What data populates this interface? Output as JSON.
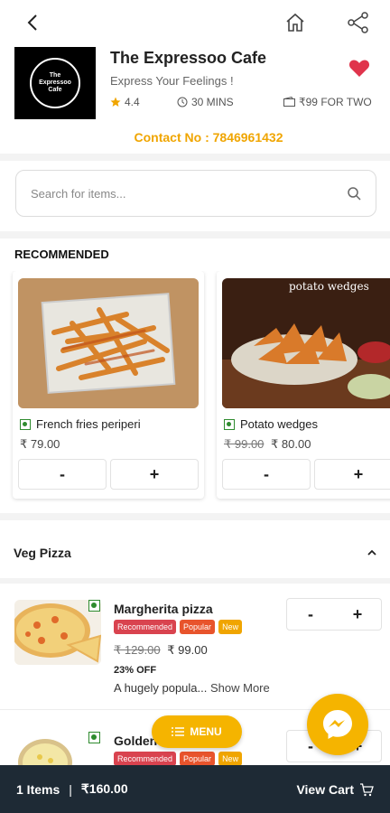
{
  "restaurant": {
    "name": "The Expressoo Cafe",
    "tagline": "Express Your Feelings !",
    "rating": "4.4",
    "time": "30 MINS",
    "cost": "₹99 FOR TWO",
    "contact": "Contact No : 7846961432",
    "logo_line1": "The",
    "logo_line2": "Expressoo",
    "logo_line3": "Cafe"
  },
  "search": {
    "placeholder": "Search for items..."
  },
  "recommended": {
    "title": "RECOMMENDED",
    "items": [
      {
        "name": "French fries periperi",
        "old_price": "",
        "price": "₹ 79.00"
      },
      {
        "name": "Potato wedges",
        "old_price": "₹ 99.00",
        "price": "₹ 80.00",
        "image_caption": "potato wedges"
      }
    ]
  },
  "stepper": {
    "minus": "-",
    "plus": "+"
  },
  "category": {
    "title": "Veg Pizza",
    "items": [
      {
        "name": "Margherita pizza",
        "badges": [
          "Recommended",
          "Popular",
          "New"
        ],
        "old_price": "₹ 129.00",
        "price": "₹ 99.00",
        "discount": "23% OFF",
        "description": "A hugely popula...",
        "more": "Show More"
      },
      {
        "name": "Golden",
        "badges": [
          "Recommended",
          "Popular",
          "New"
        ]
      }
    ]
  },
  "menu_button": "MENU",
  "cart": {
    "items": "1 Items",
    "separator": "|",
    "total": "₹160.00",
    "view": "View Cart"
  },
  "colors": {
    "accent": "#f5b400",
    "heart": "#e0344c",
    "bottom_bar": "#1e2a35",
    "veg": "#2e8b2e"
  }
}
